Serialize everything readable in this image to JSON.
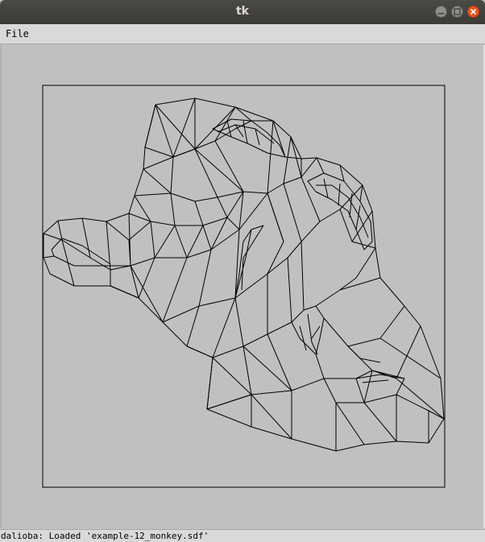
{
  "window": {
    "title": "tk"
  },
  "menubar": {
    "items": [
      {
        "label": "File"
      }
    ]
  },
  "canvas": {
    "background": "#c0c0c0",
    "stroke": "#000000",
    "model": "monkey wireframe"
  },
  "statusbar": {
    "text": "dalioba: Loaded 'example-12_monkey.sdf'"
  }
}
